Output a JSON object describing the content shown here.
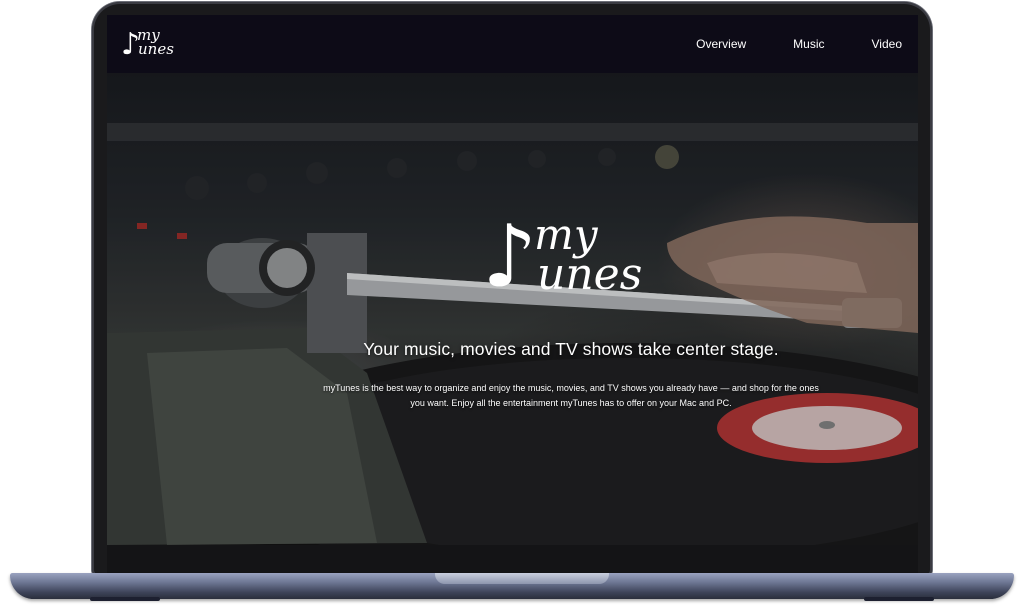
{
  "brand": {
    "logo_note": "♪",
    "logo_my": "my",
    "logo_tunes": "unes"
  },
  "nav": {
    "items": [
      {
        "label": "Overview"
      },
      {
        "label": "Music"
      },
      {
        "label": "Video"
      }
    ]
  },
  "hero": {
    "headline": "Your music, movies and TV shows take center stage.",
    "body": "myTunes is the best way to organize and enjoy the music, movies, and TV shows you already have — and shop for the ones you want. Enjoy all the entertainment myTunes has to offer on your Mac and PC.",
    "background_image": "turntable-photo"
  },
  "colors": {
    "navbar_bg": "#0d0b17",
    "text": "#ffffff",
    "laptop_body": "#1a1a1c",
    "laptop_base": "#6f7895"
  }
}
